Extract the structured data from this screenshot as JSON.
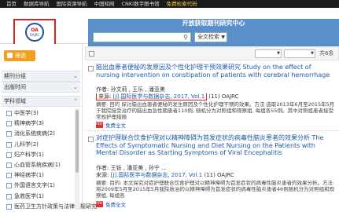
{
  "topnav": [
    "首页",
    "数据库导航",
    "国际资源导航",
    "中国知网",
    "CNKI数字图书馆",
    "免费检索代码"
  ],
  "header": {
    "logo_text": "OA",
    "logo_sub": "OAJRC",
    "center_title": "开放获取期刊研究中心",
    "search_value": "",
    "select_value": "全文检索",
    "search_icon": "search-icon"
  },
  "sidebar": {
    "filter_label": "筛选",
    "sections": [
      "期刊分组",
      "出版时间",
      "学科领域"
    ],
    "items": [
      "中医学(3)",
      "精神病学(3)",
      "消化系统疾病(2)",
      "儿科学(2)",
      "妇产科学(1)",
      "心血管系统疾病(1)",
      "神经病学(1)",
      "外国语言文字(1)",
      "急救医学(1)",
      "医药卫生方针政策与法律法规研究"
    ]
  },
  "toolbar": {
    "select1": "",
    "select2": "",
    "count_text": "共6条"
  },
  "results": [
    {
      "title": "脑出血患者便秘的发原因及个性化护理干预效果研究 Study on the effect of nursing intervention on constipation of patients with cerebral hemorrhage",
      "authors": "作者: 孙文莉 , 王乐 , 潘亚美",
      "source_label": "来源:",
      "source_link": "[J].国际医学与数据杂志, 2017, Vol.1",
      "source_tail": "(11)  OAJRC",
      "abstract": "摘要: 目的 探讨脑出血患者便秘的发生原因及个性化护理干预的效果。方法 选取2013年6月至2015年5月于我院接受治疗的脑出血急性期患者110例, 随机分为对照组和观察组, 每组各55例。其中对照组患者接受常规护理措施",
      "free_label": "免费全文"
    },
    {
      "title": "对症护理联合饮食护理对以精神障碍为首发症状的病毒性脑炎患者的效果分析 The Effects of Symptomatic Nursing and Diet Nursing on the Patients with Mental Disorder as Starting Symptoms of Viral Encephalitis",
      "authors": "作者: 王铄 , 潘亚美 , 孙宁 ...",
      "source_label": "来源:",
      "source_link": "[J].国际医学与数据杂志, 2017, Vol.1",
      "source_tail": "(11)  OAJRC",
      "abstract": "摘要: 目的: 本文探究对症护理联合饮食护理对以精神障碍为首发症状的病毒性脑炎患者的效果分析。方法: 将2009年5月至2015年5月我院收治的以精神障碍为首发症状的病毒性脑炎患者46例随机分为对照组和观察组, 每组各",
      "free_label": "免费全文"
    }
  ]
}
